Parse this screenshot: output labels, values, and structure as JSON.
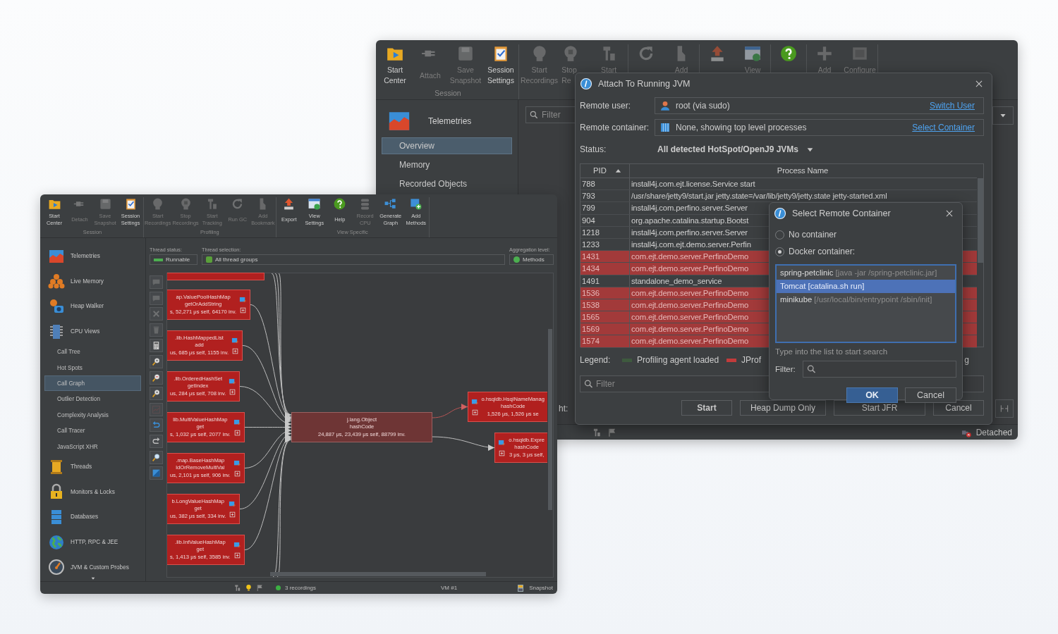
{
  "back_window": {
    "toolbar": [
      {
        "label": "Session",
        "items": [
          {
            "kind": "folder",
            "lines": [
              "Start",
              "Center"
            ],
            "disabled": false
          },
          {
            "kind": "plug",
            "label": "Attach",
            "disabled": true
          },
          {
            "kind": "disk",
            "lines": [
              "Save",
              "Snapshot"
            ],
            "disabled": true
          },
          {
            "kind": "clipboard",
            "lines": [
              "Session",
              "Settings"
            ],
            "disabled": false
          }
        ]
      },
      {
        "items": [
          {
            "kind": "record",
            "lines": [
              "Start",
              "Recordings"
            ],
            "disabled": true
          },
          {
            "kind": "stop",
            "lines": [
              "Stop",
              "Re"
            ],
            "disabled": true
          },
          {
            "kind": "pin",
            "lines": [
              "Start"
            ],
            "disabled": true
          }
        ]
      },
      {
        "items": [
          {
            "kind": "gc",
            "disabled": true
          },
          {
            "kind": "bookmark",
            "lines": [
              "Add"
            ],
            "disabled": true
          }
        ]
      },
      {
        "items": [
          {
            "kind": "export",
            "disabled": true
          },
          {
            "kind": "view",
            "lines": [
              "View"
            ],
            "disabled": true
          }
        ]
      },
      {
        "items": [
          {
            "kind": "help",
            "disabled": false
          }
        ]
      },
      {
        "items": [
          {
            "kind": "plus",
            "lines": [
              "Add"
            ],
            "disabled": true
          },
          {
            "kind": "configure",
            "lines": [
              "Configure"
            ],
            "disabled": true
          }
        ]
      }
    ],
    "sidebar": {
      "header": "Telemetries",
      "items": [
        {
          "label": "Overview",
          "selected": true
        },
        {
          "label": "Memory",
          "selected": false
        },
        {
          "label": "Recorded Objects",
          "selected": false
        }
      ]
    },
    "filter": {
      "placeholder": "Filter"
    },
    "label_fragment": "ht:",
    "status_bar": {
      "connection": "Detached"
    }
  },
  "attach_dialog": {
    "title": "Attach To Running JVM",
    "remote_user": {
      "label": "Remote user:",
      "value": "root (via sudo)",
      "link": "Switch User"
    },
    "remote_container": {
      "label": "Remote container:",
      "value": "None, showing top level processes",
      "link": "Select Container"
    },
    "status": {
      "label": "Status:",
      "value": "All detected HotSpot/OpenJ9 JVMs"
    },
    "table": {
      "columns": [
        "PID",
        "Process Name"
      ],
      "rows": [
        {
          "pid": "788",
          "name": "install4j.com.ejt.license.Service start",
          "highlighted": false
        },
        {
          "pid": "793",
          "name": "/usr/share/jetty9/start.jar jetty.state=/var/lib/jetty9/jetty.state jetty-started.xml",
          "highlighted": false
        },
        {
          "pid": "799",
          "name": "install4j.com.perfino.server.Server",
          "highlighted": false
        },
        {
          "pid": "904",
          "name": "org.apache.catalina.startup.Bootst",
          "highlighted": false
        },
        {
          "pid": "1218",
          "name": "install4j.com.perfino.server.Server",
          "highlighted": false
        },
        {
          "pid": "1233",
          "name": "install4j.com.ejt.demo.server.Perfin",
          "highlighted": false
        },
        {
          "pid": "1431",
          "name": "com.ejt.demo.server.PerfinoDemo",
          "highlighted": true
        },
        {
          "pid": "1434",
          "name": "com.ejt.demo.server.PerfinoDemo",
          "highlighted": true
        },
        {
          "pid": "1491",
          "name": "standalone_demo_service",
          "highlighted": false
        },
        {
          "pid": "1536",
          "name": "com.ejt.demo.server.PerfinoDemo",
          "highlighted": true
        },
        {
          "pid": "1538",
          "name": "com.ejt.demo.server.PerfinoDemo",
          "highlighted": true
        },
        {
          "pid": "1565",
          "name": "com.ejt.demo.server.PerfinoDemo",
          "highlighted": true
        },
        {
          "pid": "1569",
          "name": "com.ejt.demo.server.PerfinoDemo",
          "highlighted": true
        },
        {
          "pid": "1574",
          "name": "com.ejt.demo.server.PerfinoDemo",
          "highlighted": true
        }
      ]
    },
    "legend": {
      "label": "Legend:",
      "entries": [
        {
          "color": "#3e5a3e",
          "text": "Profiling agent loaded"
        },
        {
          "color": "#c23b3b",
          "text": "JProf"
        }
      ],
      "trailing": "g"
    },
    "filter": {
      "placeholder": "Filter"
    },
    "buttons": [
      {
        "label": "Start",
        "default": true
      },
      {
        "label": "Heap Dump Only",
        "default": false
      },
      {
        "label": "Start JFR",
        "default": false
      },
      {
        "label": "Cancel",
        "default": false
      }
    ]
  },
  "container_dialog": {
    "title": "Select Remote Container",
    "options": [
      {
        "label": "No container",
        "selected": false
      },
      {
        "label": "Docker container:",
        "selected": true
      }
    ],
    "containers": [
      {
        "name": "spring-petclinic",
        "command": "[java -jar /spring-petclinic.jar]",
        "selected": false
      },
      {
        "name": "Tomcat",
        "command": "[catalina.sh run]",
        "selected": true
      },
      {
        "name": "minikube",
        "command": "[/usr/local/bin/entrypoint /sbin/init]",
        "selected": false
      }
    ],
    "hint": "Type into the list to start search",
    "filter_label": "Filter:",
    "buttons": [
      {
        "label": "OK",
        "default": true
      },
      {
        "label": "Cancel",
        "default": false
      }
    ]
  },
  "front_window": {
    "toolbar": [
      {
        "label": "Session",
        "items": [
          {
            "kind": "folder",
            "lines": [
              "Start",
              "Center"
            ],
            "disabled": false
          },
          {
            "kind": "plug",
            "label": "Detach",
            "disabled": true
          },
          {
            "kind": "disk",
            "lines": [
              "Save",
              "Snapshot"
            ],
            "disabled": true
          },
          {
            "kind": "clipboard",
            "lines": [
              "Session",
              "Settings"
            ],
            "disabled": false
          }
        ]
      },
      {
        "label": "Profiling",
        "items": [
          {
            "kind": "record",
            "lines": [
              "Start",
              "Recordings"
            ],
            "disabled": true
          },
          {
            "kind": "stop",
            "lines": [
              "Stop",
              "Recordings"
            ],
            "disabled": true
          },
          {
            "kind": "pin",
            "lines": [
              "Start",
              "Tracking"
            ],
            "disabled": true
          },
          {
            "kind": "gc",
            "label": "Run GC",
            "disabled": true
          },
          {
            "kind": "bookmark",
            "lines": [
              "Add",
              "Bookmark"
            ],
            "disabled": true
          }
        ]
      },
      {
        "label": "View Specific",
        "items": [
          {
            "kind": "export",
            "label": "Export",
            "disabled": false
          },
          {
            "kind": "view",
            "lines": [
              "View",
              "Settings"
            ],
            "disabled": false
          },
          {
            "kind": "help",
            "label": "Help",
            "disabled": false
          },
          {
            "kind": "stack",
            "lines": [
              "Record",
              "CPU"
            ],
            "disabled": true
          },
          {
            "kind": "graph",
            "lines": [
              "Generate",
              "Graph"
            ],
            "disabled": false
          },
          {
            "kind": "addm",
            "lines": [
              "Add",
              "Methods"
            ],
            "disabled": false
          }
        ]
      }
    ],
    "sidebar": [
      {
        "label": "Telemetries",
        "kind": "chart",
        "selected": false
      },
      {
        "label": "Live Memory",
        "kind": "blocks",
        "selected": false
      },
      {
        "label": "Heap Walker",
        "kind": "camera",
        "selected": false
      },
      {
        "label": "CPU Views",
        "kind": "chip",
        "selected": false,
        "children": [
          {
            "label": "Call Tree",
            "selected": false
          },
          {
            "label": "Hot Spots",
            "selected": false
          },
          {
            "label": "Call Graph",
            "selected": true
          },
          {
            "label": "Outlier Detection",
            "selected": false
          },
          {
            "label": "Complexity Analysis",
            "selected": false
          },
          {
            "label": "Call Tracer",
            "selected": false
          },
          {
            "label": "JavaScript XHR",
            "selected": false
          }
        ]
      },
      {
        "label": "Threads",
        "kind": "spool",
        "selected": false
      },
      {
        "label": "Monitors & Locks",
        "kind": "lock",
        "selected": false
      },
      {
        "label": "Databases",
        "kind": "database",
        "selected": false
      },
      {
        "label": "HTTP, RPC & JEE",
        "kind": "globe",
        "selected": false
      },
      {
        "label": "JVM & Custom Probes",
        "kind": "gauge",
        "selected": false
      }
    ],
    "thread_status": {
      "label": "Thread status:",
      "value": "Runnable"
    },
    "thread_selection": {
      "label": "Thread selection:",
      "value": "All thread groups"
    },
    "aggregation": {
      "label": "Aggregation level:",
      "value": "Methods"
    },
    "graph_tools": [
      {
        "kind": "note",
        "disabled": true
      },
      {
        "kind": "note",
        "disabled": true
      },
      {
        "kind": "cross",
        "disabled": true
      },
      {
        "kind": "trash",
        "disabled": true
      },
      {
        "kind": "calc",
        "disabled": false
      },
      {
        "kind": "zoomin",
        "disabled": false
      },
      {
        "kind": "zoomout",
        "disabled": false
      },
      {
        "kind": "zoomfit",
        "disabled": false
      },
      {
        "kind": "redchart",
        "disabled": true
      },
      {
        "kind": "undo",
        "disabled": false
      },
      {
        "kind": "redo",
        "disabled": false
      },
      {
        "kind": "search",
        "disabled": false
      },
      {
        "kind": "picture",
        "disabled": false
      }
    ],
    "graph": {
      "nodes": [
        {
          "kind": "caller",
          "lines": [
            "ap.ValuePoolHashMap",
            "getOrAddString",
            "s, 52,271 μs self, 64170 inv."
          ]
        },
        {
          "kind": "caller",
          "lines": [
            ".lib.HashMappedList",
            "add",
            "us, 685 μs self, 1155 inv."
          ]
        },
        {
          "kind": "caller",
          "lines": [
            ".lib.OrderedHashSet",
            "getIndex",
            "us, 284 μs self, 708 inv."
          ]
        },
        {
          "kind": "caller",
          "lines": [
            "lib.MultiValueHashMap",
            "get",
            "s, 1,032 μs self, 2077 inv."
          ]
        },
        {
          "kind": "caller",
          "lines": [
            ".map.BaseHashMap",
            "ldOrRemoveMultiVal",
            "us, 2,101 μs self, 906 inv."
          ]
        },
        {
          "kind": "caller",
          "lines": [
            "b.LongValueHashMap",
            "get",
            "us, 382 μs self, 334 inv."
          ]
        },
        {
          "kind": "caller",
          "lines": [
            ".lib.IntValueHashMap",
            "get",
            "s, 1,413 μs self, 3585 inv."
          ]
        },
        {
          "kind": "focus",
          "lines": [
            "j.lang.Object",
            "hashCode",
            "24,887 μs, 23,439 μs self, 88799 inv."
          ]
        },
        {
          "kind": "callee",
          "edge_highlighted": true,
          "lines": [
            "o.hsqldb.HsqlNameManag",
            "hashCode",
            "1,526 μs, 1,526 μs se"
          ]
        },
        {
          "kind": "callee",
          "edge_highlighted": false,
          "lines": [
            "o.hsqldb.Expre",
            "hashCode",
            "3 μs, 3 μs self,"
          ]
        }
      ]
    },
    "status_bar": {
      "recordings": "3 recordings",
      "vm": "VM #1",
      "snapshot": "Snapshot"
    }
  }
}
